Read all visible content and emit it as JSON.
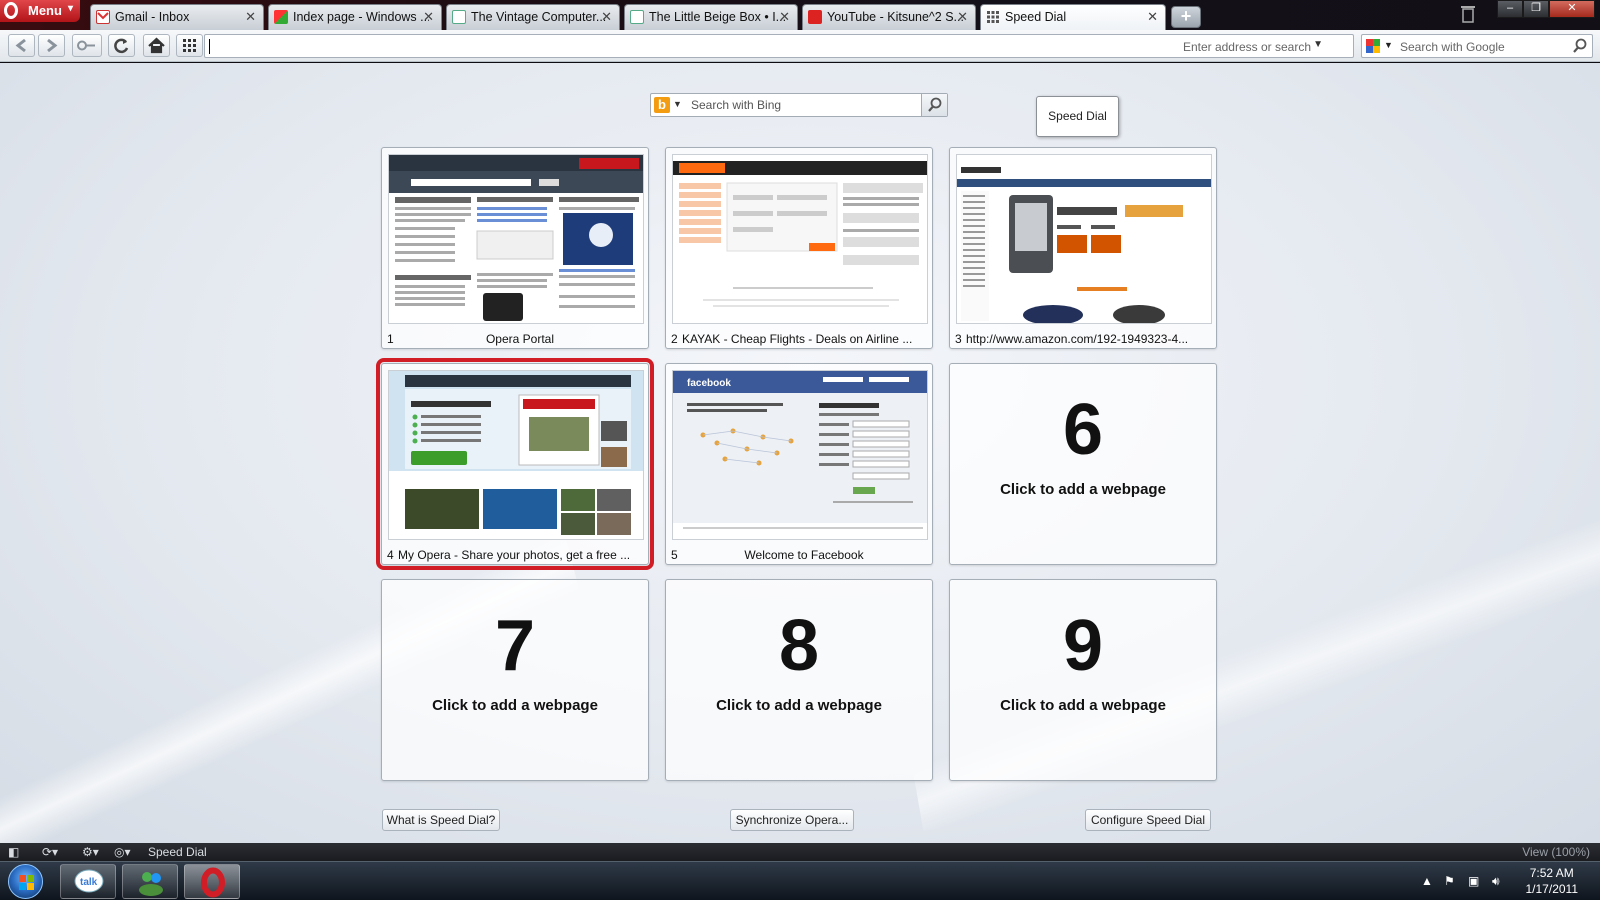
{
  "menu": {
    "label": "Menu"
  },
  "tabs": [
    {
      "title": "Gmail - Inbox",
      "icon": "gmail-icon",
      "active": false
    },
    {
      "title": "Index page - Windows ...",
      "icon": "windows-page-icon",
      "active": false
    },
    {
      "title": "The Vintage Computer...",
      "icon": "page-icon",
      "active": false
    },
    {
      "title": "The Little Beige Box • I...",
      "icon": "page-icon",
      "active": false
    },
    {
      "title": "YouTube - Kitsune^2 S...",
      "icon": "youtube-icon",
      "active": false
    },
    {
      "title": "Speed Dial",
      "icon": "speed-dial-icon",
      "active": true
    }
  ],
  "tooltip": "Speed Dial",
  "address": {
    "value": "",
    "placeholder": "Enter address or search"
  },
  "search": {
    "placeholder": "Search with Google",
    "engine_icon": "google-icon"
  },
  "speed_dial": {
    "search_placeholder": "Search with Bing",
    "search_engine_icon": "bing-icon",
    "cells": [
      {
        "number": "1",
        "title": "Opera Portal",
        "thumbnail": "opera-portal"
      },
      {
        "number": "2",
        "title": "KAYAK - Cheap Flights - Deals on Airline ...",
        "thumbnail": "kayak"
      },
      {
        "number": "3",
        "title": "http://www.amazon.com/192-1949323-4...",
        "thumbnail": "amazon"
      },
      {
        "number": "4",
        "title": "My Opera - Share your photos, get a free ...",
        "thumbnail": "my-opera",
        "selected": true
      },
      {
        "number": "5",
        "title": "Welcome to Facebook",
        "thumbnail": "facebook"
      },
      {
        "number": "6",
        "empty_label": "Click to add a webpage"
      },
      {
        "number": "7",
        "empty_label": "Click to add a webpage"
      },
      {
        "number": "8",
        "empty_label": "Click to add a webpage"
      },
      {
        "number": "9",
        "empty_label": "Click to add a webpage"
      }
    ],
    "buttons": {
      "what_is": "What is Speed Dial?",
      "sync": "Synchronize Opera...",
      "configure": "Configure Speed Dial"
    }
  },
  "statusbar": {
    "page_label": "Speed Dial",
    "zoom": "View (100%)"
  },
  "taskbar": {
    "apps": [
      "google-talk-icon",
      "windows-live-messenger-icon",
      "opera-icon"
    ],
    "time": "7:52 AM",
    "date": "1/17/2011"
  },
  "colors": {
    "selection_outline": "#d11d26",
    "opera_red": "#c8181d",
    "facebook_blue": "#3b5998",
    "kayak_orange": "#ff690f"
  }
}
